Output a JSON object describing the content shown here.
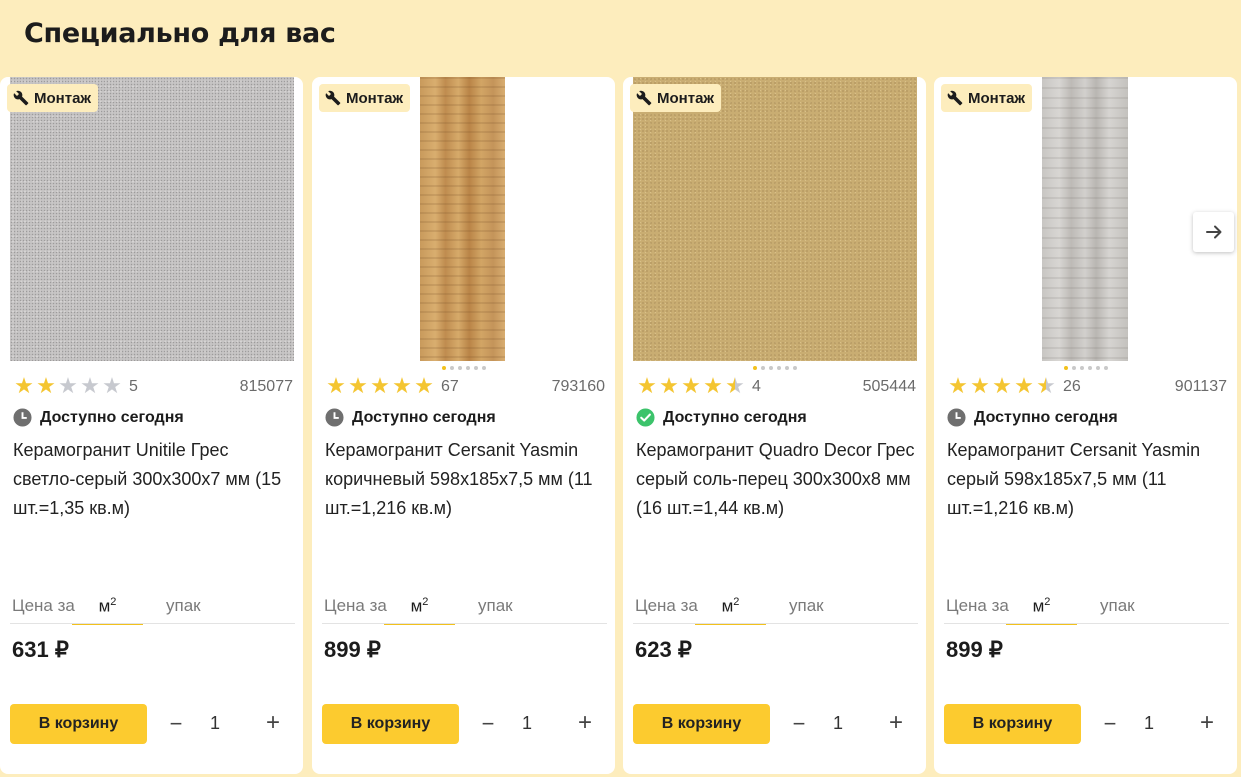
{
  "section": {
    "title": "Специально для вас"
  },
  "common": {
    "badge": "Монтаж",
    "availability": "Доступно сегодня",
    "price_label": "Цена за",
    "unit_m": "м",
    "unit_m_sup": "2",
    "unit_pack": "упак",
    "cart_button": "В корзину",
    "qty_minus": "−",
    "qty_plus": "+",
    "currency": "₽"
  },
  "products": [
    {
      "rating": 2,
      "reviews": "5",
      "sku": "815077",
      "availability_icon": "clock-icon",
      "name": "Керамогранит Unitile Грес светло-серый 300x300x7 мм (15 шт.=1,35 кв.м)",
      "price": "631",
      "qty": "1",
      "image": "gray-speckled-tile",
      "gallery_dots": 0
    },
    {
      "rating": 5,
      "reviews": "67",
      "sku": "793160",
      "availability_icon": "clock-icon",
      "name": "Керамогранит Cersanit Yasmin коричневый 598x185x7,5 мм (11 шт.=1,216 кв.м)",
      "price": "899",
      "qty": "1",
      "image": "brown-wood-plank",
      "gallery_dots": 6
    },
    {
      "rating": 4.5,
      "reviews": "4",
      "sku": "505444",
      "availability_icon": "check-circle-icon",
      "name": "Керамогранит Quadro Decor Грес серый соль-перец 300x300x8 мм (16 шт.=1,44 кв.м)",
      "price": "623",
      "qty": "1",
      "image": "beige-speckled-tile",
      "gallery_dots": 6
    },
    {
      "rating": 4.5,
      "reviews": "26",
      "sku": "901137",
      "availability_icon": "clock-icon",
      "name": "Керамогранит Cersanit Yasmin серый 598x185x7,5 мм (11 шт.=1,216 кв.м)",
      "price": "899",
      "qty": "1",
      "image": "gray-wood-plank",
      "gallery_dots": 6
    }
  ],
  "carousel": {
    "next_icon": "arrow-right-icon"
  },
  "colors": {
    "background": "#fdedbd",
    "accent": "#fccb2f",
    "star": "#f4c531",
    "available": "#3cc36b"
  }
}
